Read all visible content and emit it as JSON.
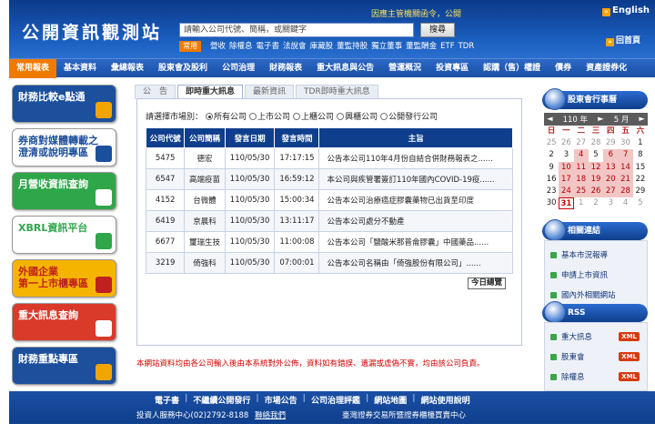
{
  "header": {
    "site_title": "公開資訊觀測站",
    "notice": "因應主管機關函令，公開",
    "english": "English",
    "home": "回首頁",
    "search_placeholder": "請輸入公司代號、簡稱，或關鍵字",
    "search_button": "搜尋",
    "common_tag": "常用",
    "quick_links": [
      "營收",
      "除權息",
      "電子書",
      "法說會",
      "庫藏股",
      "董監持股",
      "獨立董事",
      "董監酬金",
      "ETF",
      "TDR"
    ]
  },
  "nav": {
    "items": [
      "常用報表",
      "基本資料",
      "彙總報表",
      "股東會及股利",
      "公司治理",
      "財務報表",
      "重大訊息與公告",
      "營運概況",
      "投資專區",
      "認購（售）權證",
      "債券",
      "資產證券化"
    ]
  },
  "left_banners": [
    {
      "label": "財務比較e點通",
      "bg": "#1c4f9c",
      "fg": "#ffffff",
      "deco": "#f2a400"
    },
    {
      "label": "券商對媒體轉載之\n澄清或說明專區",
      "bg": "#ffffff",
      "fg": "#1c4f9c",
      "deco": "#1c4f9c"
    },
    {
      "label": "月營收資訊查詢",
      "bg": "#2fa64a",
      "fg": "#ffffff",
      "deco": "#ffffff"
    },
    {
      "label": "XBRL資訊平台",
      "bg": "#ffffff",
      "fg": "#2fa64a",
      "deco": "#2fa64a"
    },
    {
      "label": "外國企業\n第一上市櫃專區",
      "bg": "#f5b400",
      "fg": "#c02020",
      "deco": "#c02020"
    },
    {
      "label": "重大訊息查詢",
      "bg": "#d93a2a",
      "fg": "#ffffff",
      "deco": "#ffffff"
    },
    {
      "label": "財務重點專區",
      "bg": "#1c4f9c",
      "fg": "#ffffff",
      "deco": "#f2a400"
    }
  ],
  "tabs": [
    {
      "label": "公　告",
      "active": false
    },
    {
      "label": "即時重大訊息",
      "active": true
    },
    {
      "label": "最新資訊",
      "active": false
    },
    {
      "label": "TDR即時重大訊息",
      "active": false
    }
  ],
  "market_filter": {
    "label": "請選擇市場別：",
    "options": [
      {
        "label": "所有公司",
        "selected": true
      },
      {
        "label": "上市公司",
        "selected": false
      },
      {
        "label": "上櫃公司",
        "selected": false
      },
      {
        "label": "興櫃公司",
        "selected": false
      },
      {
        "label": "公開發行公司",
        "selected": false
      }
    ]
  },
  "table": {
    "headers": [
      "公司代號",
      "公司簡稱",
      "發言日期",
      "發言時間",
      "主旨"
    ],
    "rows": [
      [
        "5475",
        "德宏",
        "110/05/30",
        "17:17:15",
        "公告本公司110年4月份自結合併財務報表之......"
      ],
      [
        "6547",
        "高端疫苗",
        "110/05/30",
        "16:59:12",
        "本公司與疾管署簽訂110年國內COVID-19疫......"
      ],
      [
        "4152",
        "台微體",
        "110/05/30",
        "15:00:34",
        "公告本公司治療癌症膠囊藥物已出貨至印度"
      ],
      [
        "6419",
        "京晨科",
        "110/05/30",
        "13:11:17",
        "公告本公司處分不動產"
      ],
      [
        "6677",
        "璽瑞生技",
        "110/05/30",
        "11:00:08",
        "公告本公司「鹽酸米那普侖膠囊」中國藥品......"
      ],
      [
        "3219",
        "倚強科",
        "110/05/30",
        "07:00:01",
        "公告本公司名稱由「倚強股份有限公司」......"
      ]
    ]
  },
  "today_button": "今日總覽",
  "disclaimer": "本網站資料均由各公司輸入後由本系統對外公佈，資料如有錯誤、遺漏或虛偽不實，均由該公司負責。",
  "sidebar": {
    "calendar_title": "股東會行事曆",
    "calendar_year": "110 年",
    "calendar_month": "5 月",
    "weekdays": [
      "日",
      "一",
      "二",
      "三",
      "四",
      "五",
      "六"
    ],
    "days": [
      {
        "d": "25",
        "t": "dim"
      },
      {
        "d": "26",
        "t": "dim"
      },
      {
        "d": "27",
        "t": "dim"
      },
      {
        "d": "28",
        "t": "dim"
      },
      {
        "d": "29",
        "t": "dim"
      },
      {
        "d": "30",
        "t": "dim"
      },
      {
        "d": "1",
        "t": ""
      },
      {
        "d": "2",
        "t": ""
      },
      {
        "d": "3",
        "t": ""
      },
      {
        "d": "4",
        "t": "hi"
      },
      {
        "d": "5",
        "t": ""
      },
      {
        "d": "6",
        "t": "hi"
      },
      {
        "d": "7",
        "t": "hi"
      },
      {
        "d": "8",
        "t": ""
      },
      {
        "d": "9",
        "t": ""
      },
      {
        "d": "10",
        "t": "hi"
      },
      {
        "d": "11",
        "t": "hi"
      },
      {
        "d": "12",
        "t": "hi"
      },
      {
        "d": "13",
        "t": "hi"
      },
      {
        "d": "14",
        "t": "hi"
      },
      {
        "d": "15",
        "t": ""
      },
      {
        "d": "16",
        "t": ""
      },
      {
        "d": "17",
        "t": "hi"
      },
      {
        "d": "18",
        "t": "hi"
      },
      {
        "d": "19",
        "t": "hi"
      },
      {
        "d": "20",
        "t": "hi"
      },
      {
        "d": "21",
        "t": "hi"
      },
      {
        "d": "22",
        "t": ""
      },
      {
        "d": "23",
        "t": ""
      },
      {
        "d": "24",
        "t": "hi"
      },
      {
        "d": "25",
        "t": "hi"
      },
      {
        "d": "26",
        "t": "hi"
      },
      {
        "d": "27",
        "t": "hi"
      },
      {
        "d": "28",
        "t": "hi"
      },
      {
        "d": "29",
        "t": ""
      },
      {
        "d": "30",
        "t": ""
      },
      {
        "d": "31",
        "t": "sel"
      },
      {
        "d": "1",
        "t": "dim"
      },
      {
        "d": "2",
        "t": "dim"
      },
      {
        "d": "3",
        "t": "dim"
      },
      {
        "d": "4",
        "t": "dim"
      },
      {
        "d": "5",
        "t": "dim"
      }
    ],
    "related_title": "相關連結",
    "related_links": [
      "基本市況報導",
      "申請上市資訊",
      "國內外相關網站"
    ],
    "rss_title": "RSS",
    "rss_items": [
      "重大訊息",
      "股東會",
      "除權息"
    ],
    "xml_label": "XML"
  },
  "footer": {
    "links": [
      "電子書",
      "不繼續公開發行",
      "市場公告",
      "公司治理評鑑",
      "網站地圖",
      "網站使用說明"
    ],
    "service": "投資人服務中心(02)2792-8188",
    "contact": "聯絡我們",
    "copyright": "臺灣證券交易所暨證券櫃檯買賣中心"
  }
}
